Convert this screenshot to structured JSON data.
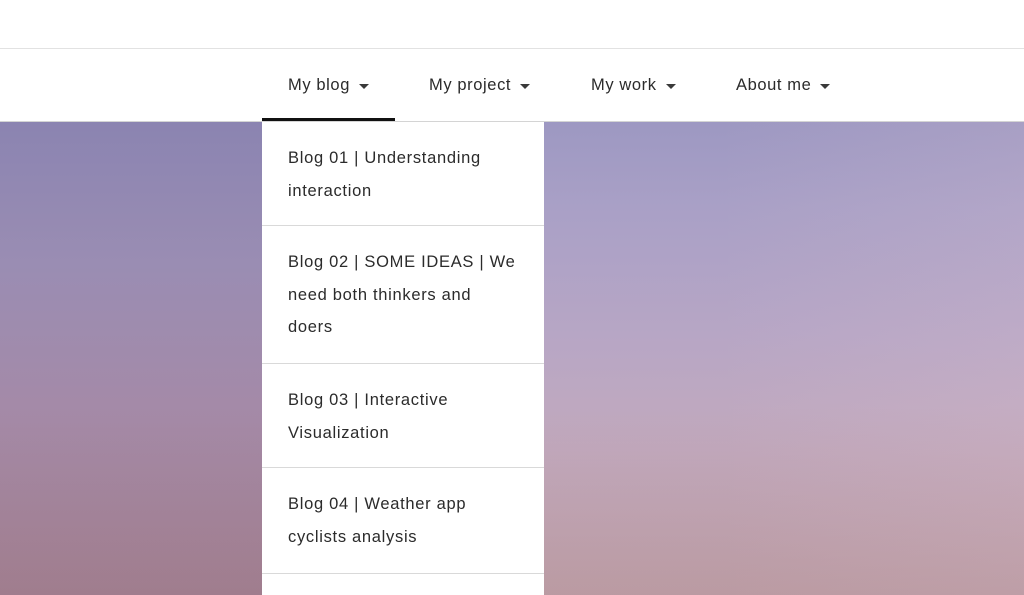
{
  "nav": {
    "items": [
      {
        "label": "My blog",
        "active": true
      },
      {
        "label": "My project",
        "active": false
      },
      {
        "label": "My work",
        "active": false
      },
      {
        "label": "About me",
        "active": false
      }
    ]
  },
  "dropdown": {
    "items": [
      {
        "label": "Blog 01 | Understanding interaction"
      },
      {
        "label": "Blog 02 | SOME IDEAS | We need both thinkers and doers"
      },
      {
        "label": "Blog 03 | Interactive Visualization"
      },
      {
        "label": "Blog 04 | Weather app cyclists analysis"
      },
      {
        "label": ""
      }
    ]
  },
  "colors": {
    "text": "#2b2b2b",
    "active_underline": "#111111",
    "hero_top": "#9d98c2",
    "hero_bottom": "#c9abb0"
  },
  "icons": {
    "nav_caret": "caret-down-icon"
  }
}
